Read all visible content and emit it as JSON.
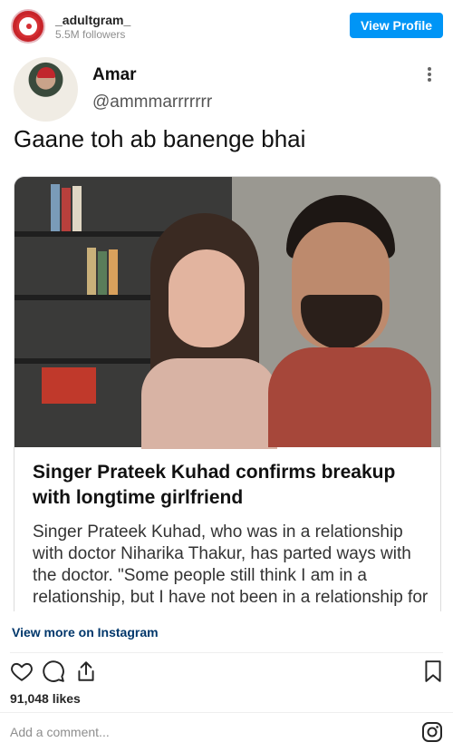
{
  "account": {
    "username": "_adultgram_",
    "followers": "5.5M followers",
    "view_profile_label": "View Profile"
  },
  "tweet": {
    "name": "Amar",
    "handle": "@ammmarrrrrrr",
    "text": "Gaane toh ab banenge bhai"
  },
  "news": {
    "headline": "Singer Prateek Kuhad confirms breakup with longtime girlfriend",
    "body": "Singer Prateek Kuhad, who was in a relationship with doctor Niharika Thakur, has parted ways with the doctor. \"Some people still think I am in a relationship, but I have not been in a relationship for a little while now. Things ended some time"
  },
  "view_more_label": "View more on Instagram",
  "likes": "91,048 likes",
  "comment_placeholder": "Add a comment...",
  "colors": {
    "accent": "#0095f6",
    "link": "#00376b",
    "muted": "#8e8e8e"
  },
  "icons": [
    "heart-icon",
    "comment-icon",
    "share-icon",
    "bookmark-icon",
    "instagram-icon",
    "more-dots-icon"
  ]
}
